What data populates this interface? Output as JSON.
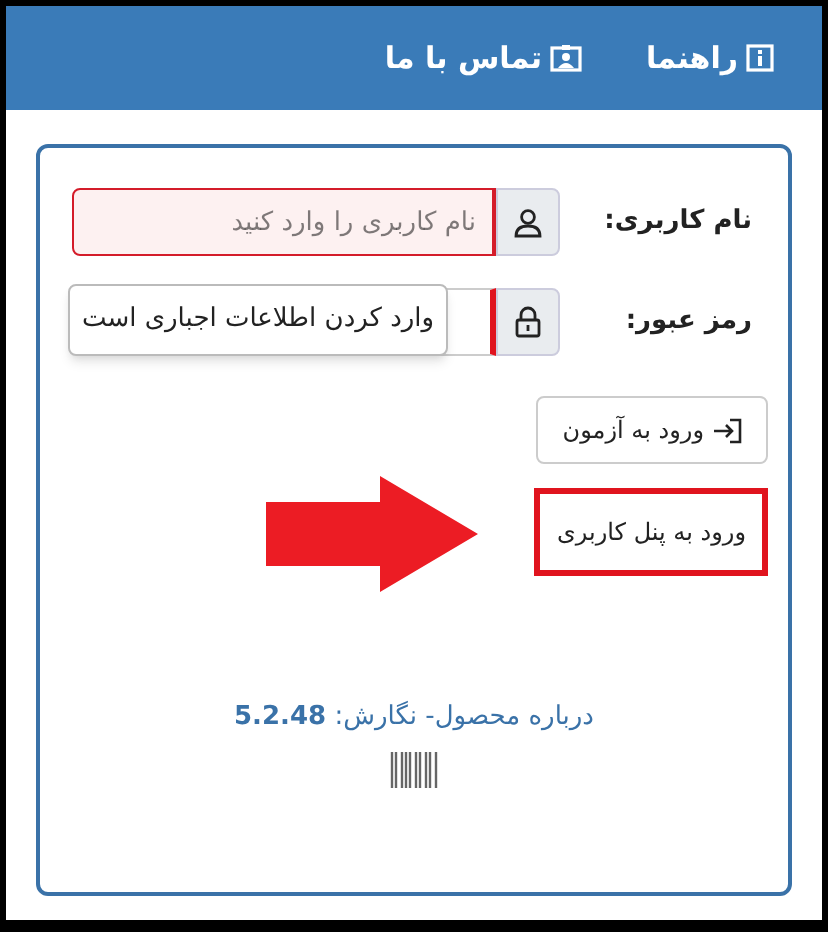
{
  "nav": {
    "items": [
      {
        "label": "راهنما",
        "kind": "info"
      },
      {
        "label": "تماس با ما",
        "kind": "contact"
      }
    ]
  },
  "form": {
    "fields": [
      {
        "label": "نام کاربری:",
        "kind": "user",
        "placeholder": "نام کاربری را وارد کنید",
        "invalid": true
      },
      {
        "label": "رمز عبور:",
        "kind": "lock",
        "invalid": true,
        "tooltip": "وارد کردن اطلاعات اجباری است"
      }
    ],
    "buttons": [
      {
        "label": "ورود به آزمون",
        "kind": "exam",
        "highlighted": false
      },
      {
        "label": "ورود به پنل کاربری",
        "kind": "panel",
        "highlighted": true
      }
    ]
  },
  "footer": {
    "about": "درباره محصول- نگارش: **5.2.48**"
  }
}
